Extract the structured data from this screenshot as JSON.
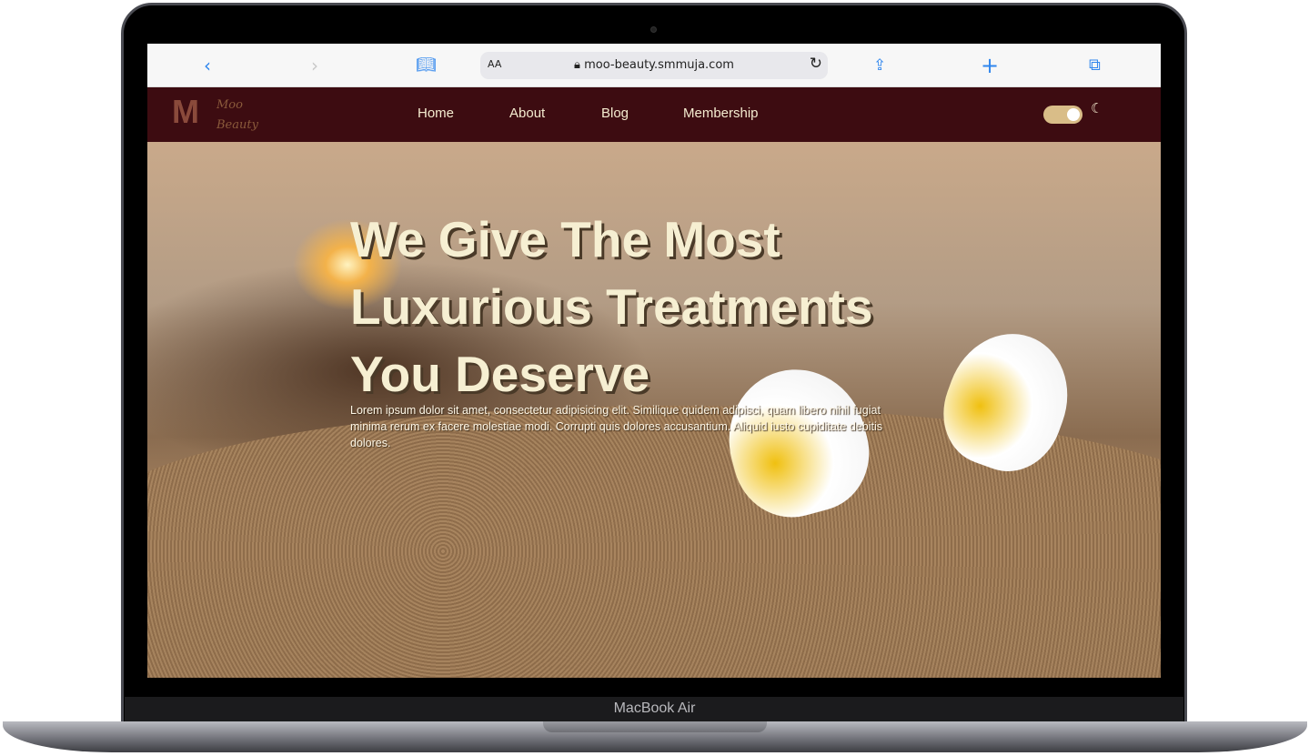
{
  "device": {
    "label": "MacBook Air"
  },
  "browser": {
    "text_size": "AA",
    "url": "moo-beauty.smmuja.com",
    "icons": [
      "back-icon",
      "forward-icon",
      "bookmarks-icon",
      "lock-icon",
      "reload-icon",
      "share-icon",
      "new-tab-icon",
      "tabs-icon"
    ]
  },
  "site": {
    "logo": {
      "letter": "M",
      "line1": "Moo",
      "line2": "Beauty"
    },
    "nav": [
      {
        "label": "Home"
      },
      {
        "label": "About"
      },
      {
        "label": "Blog"
      },
      {
        "label": "Membership"
      }
    ],
    "theme_toggle": {
      "on": true,
      "icon": "moon-icon"
    },
    "hero": {
      "title": "We Give The Most Luxurious Treatments You Deserve",
      "description": "Lorem ipsum dolor sit amet, consectetur adipisicing elit. Similique quidem adipisci, quam libero nihil fugiat minima rerum ex facere molestiae modi. Corrupti quis dolores accusantium. Aliquid iusto cupiditate debitis dolores."
    }
  },
  "colors": {
    "nav_bg": "#3d0c11",
    "accent": "#d9bd88",
    "browser_blue": "#2f86ee"
  }
}
